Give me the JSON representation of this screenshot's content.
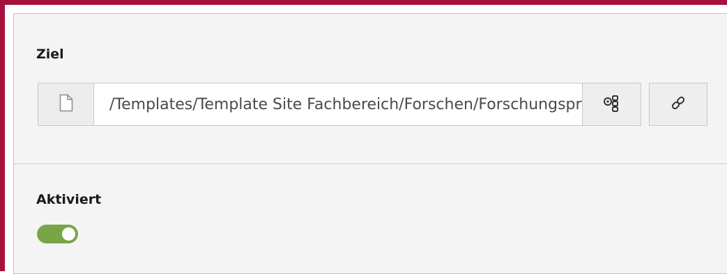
{
  "target": {
    "label": "Ziel",
    "value": "/Templates/Template Site Fachbereich/Forschen/Forschungsprojekte",
    "type_icon": "page-icon",
    "browse_icon": "page-tree-icon",
    "link_icon": "link-icon"
  },
  "activated": {
    "label": "Aktiviert",
    "state": true
  },
  "colors": {
    "accent_border": "#a6113b",
    "toggle_on": "#79a548"
  }
}
